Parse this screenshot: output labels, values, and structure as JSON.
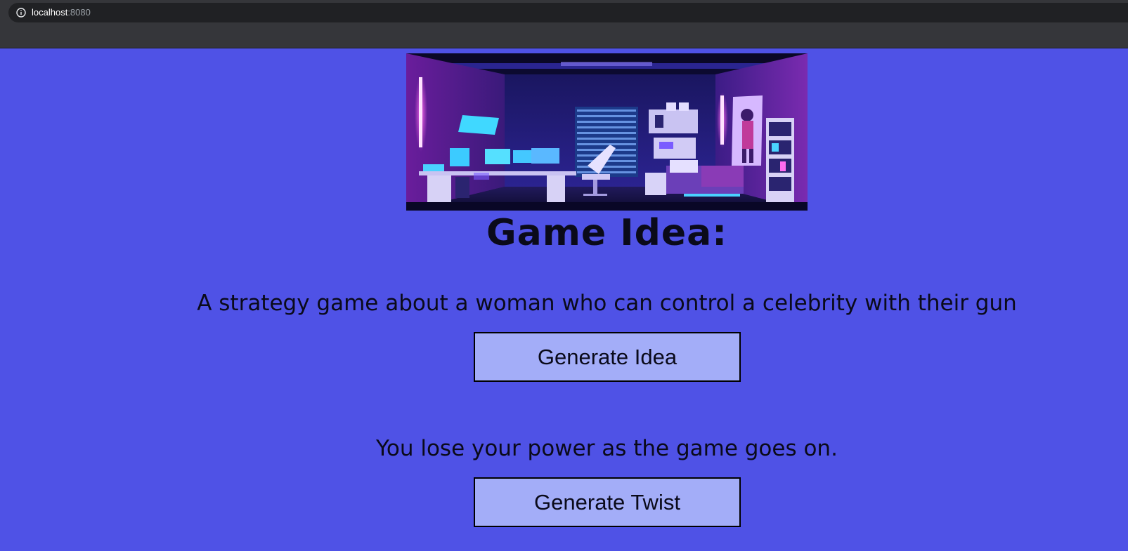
{
  "browser": {
    "host": "localhost",
    "port": ":8080"
  },
  "page": {
    "title": "Game Idea:",
    "idea": "A strategy game about a woman who can control a celebrity with their gun",
    "generate_idea_label": "Generate Idea",
    "twist": "You lose your power as the game goes on.",
    "generate_twist_label": "Generate Twist"
  },
  "colors": {
    "background": "#4f52e6",
    "button": "#a3adf8"
  },
  "icons": {
    "address_bar": "info-icon"
  }
}
